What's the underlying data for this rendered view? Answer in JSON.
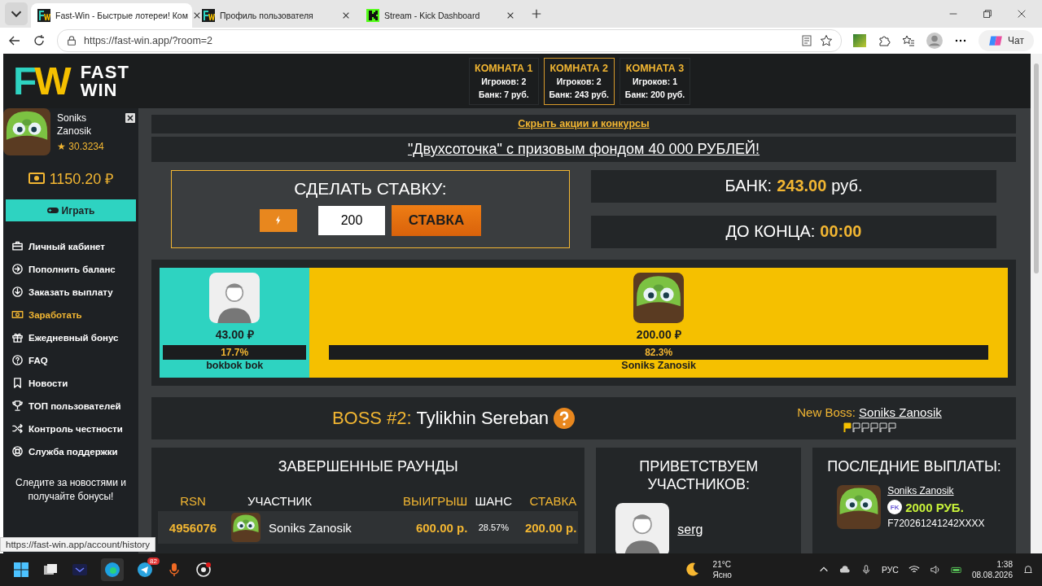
{
  "browser": {
    "tabs": [
      {
        "title": "Fast-Win - Быстрые лотереи! Ком",
        "selected": true,
        "kind": "fw"
      },
      {
        "title": "Профиль пользователя",
        "selected": false,
        "kind": "fw"
      },
      {
        "title": "Stream - Kick Dashboard",
        "selected": false,
        "kind": "kick"
      }
    ],
    "url": "https://fast-win.app/?room=2",
    "chat_label": "Чат"
  },
  "header": {
    "logo_mark": [
      "F",
      "W"
    ],
    "logo_text": [
      "FAST",
      "WIN"
    ],
    "rooms": [
      {
        "title": "КОМНАТА 1",
        "players": "Игроков: 2",
        "bank": "Банк: 7 руб.",
        "selected": false
      },
      {
        "title": "КОМНАТА 2",
        "players": "Игроков: 2",
        "bank": "Банк: 243 руб.",
        "selected": true
      },
      {
        "title": "КОМНАТА 3",
        "players": "Игроков: 1",
        "bank": "Банк: 200 руб.",
        "selected": false
      }
    ]
  },
  "sidebar": {
    "name": "Soniks Zanosik",
    "rating": "★ 30.3234",
    "balance": "1150.20 ₽",
    "play_button": "Играть",
    "items": [
      {
        "label": "Личный кабинет",
        "selected": false
      },
      {
        "label": "Пополнить баланс",
        "selected": false
      },
      {
        "label": "Заказать выплату",
        "selected": false
      },
      {
        "label": "Заработать",
        "selected": true
      },
      {
        "label": "Ежедневный бонус",
        "selected": false
      },
      {
        "label": "FAQ",
        "selected": false
      },
      {
        "label": "Новости",
        "selected": false
      },
      {
        "label": "ТОП пользователей",
        "selected": false
      },
      {
        "label": "Контроль честности",
        "selected": false
      },
      {
        "label": "Служба поддержки",
        "selected": false
      }
    ],
    "footer": "Следите за новостями и получайте бонусы!"
  },
  "promo": {
    "hide_link": "Скрыть акции и конкурсы",
    "banner": "\"Двухсоточка\" с призовым фондом 40 000 РУБЛЕЙ!"
  },
  "bet": {
    "title": "СДЕЛАТЬ СТАВКУ:",
    "amount": "200",
    "submit": "СТАВКА"
  },
  "bank": {
    "label": "БАНК:",
    "value": "243.00",
    "unit": "руб."
  },
  "timer": {
    "label": "ДО КОНЦА:",
    "value": "00:00"
  },
  "players": [
    {
      "kind": "silhouette",
      "amount": "43.00 ₽",
      "share": "17.7%",
      "name": "bokbok bok",
      "level": 0.177,
      "color": "#2ed3c1"
    },
    {
      "kind": "pig",
      "amount": "200.00 ₽",
      "share": "82.3%",
      "name": "Soniks Zanosik",
      "level": 0.823,
      "color": "#f5c000"
    }
  ],
  "boss": {
    "label": "BOSS #2:",
    "name": "Tylikhin Sereban",
    "new_boss_label": "New Boss:",
    "new_boss_name": "Soniks Zanosik",
    "flags": [
      {
        "filled": true
      },
      {
        "filled": false
      },
      {
        "filled": false
      },
      {
        "filled": false
      },
      {
        "filled": false
      },
      {
        "filled": false
      }
    ]
  },
  "rounds": {
    "title": "ЗАВЕРШЕННЫЕ РАУНДЫ",
    "columns": [
      "RSN",
      "УЧАСТНИК",
      "ВЫИГРЫШ",
      "ШАНС",
      "СТАВКА"
    ],
    "rows": [
      {
        "rsn": "4956076",
        "player": "Soniks Zanosik",
        "win": "600.00 р.",
        "chance": "28.57%",
        "bet": "200.00 р."
      }
    ]
  },
  "welcome": {
    "title": "ПРИВЕТСТВУЕМ УЧАСТНИКОВ:",
    "users": [
      {
        "name": "serg"
      }
    ]
  },
  "payouts": {
    "title": "ПОСЛЕДНИЕ ВЫПЛАТЫ:",
    "items": [
      {
        "name": "Soniks Zanosik",
        "method": "FK",
        "amount": "2000 РУБ.",
        "wallet": "F720261241242XXXX"
      }
    ]
  },
  "status_url": "https://fast-win.app/account/history",
  "taskbar": {
    "telegram_badge": "82",
    "temp": "21°C",
    "weather": "Ясно",
    "lang": "РУС",
    "time": "1:38",
    "date": "08.08.2026"
  }
}
